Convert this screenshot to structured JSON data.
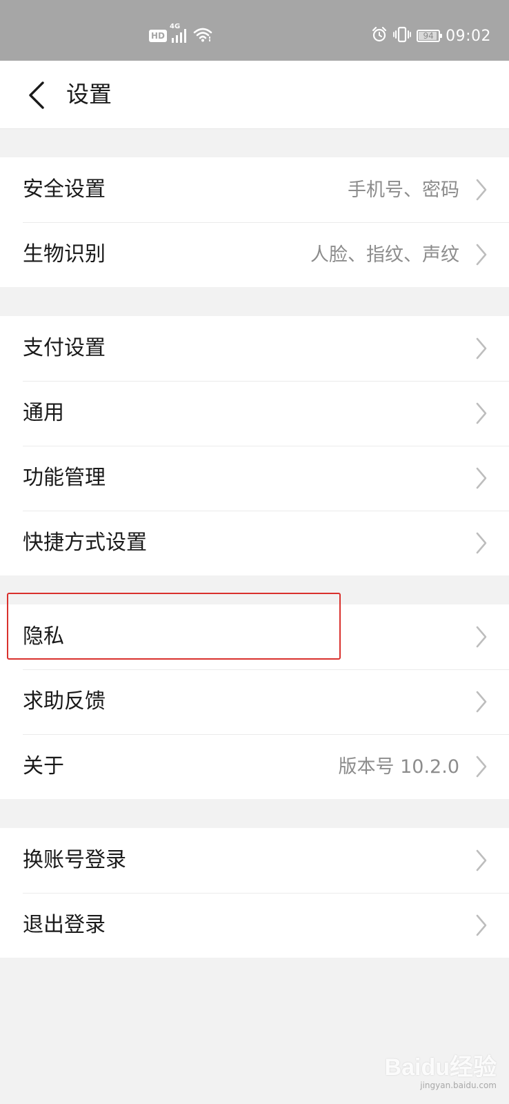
{
  "status_bar": {
    "hd": "HD",
    "network": "4G",
    "battery": "94",
    "time": "09:02"
  },
  "header": {
    "title": "设置"
  },
  "groups": [
    {
      "items": [
        {
          "label": "安全设置",
          "value": "手机号、密码"
        },
        {
          "label": "生物识别",
          "value": "人脸、指纹、声纹"
        }
      ]
    },
    {
      "items": [
        {
          "label": "支付设置",
          "value": ""
        },
        {
          "label": "通用",
          "value": ""
        },
        {
          "label": "功能管理",
          "value": ""
        },
        {
          "label": "快捷方式设置",
          "value": ""
        }
      ]
    },
    {
      "items": [
        {
          "label": "隐私",
          "value": ""
        },
        {
          "label": "求助反馈",
          "value": ""
        },
        {
          "label": "关于",
          "value": "版本号 10.2.0"
        }
      ]
    },
    {
      "items": [
        {
          "label": "换账号登录",
          "value": ""
        },
        {
          "label": "退出登录",
          "value": ""
        }
      ]
    }
  ],
  "watermark": {
    "logo": "Baidu经验",
    "url": "jingyan.baidu.com"
  },
  "colors": {
    "status_bar_bg": "#a6a6a6",
    "page_bg": "#f2f2f2",
    "highlight": "#d9302c"
  }
}
